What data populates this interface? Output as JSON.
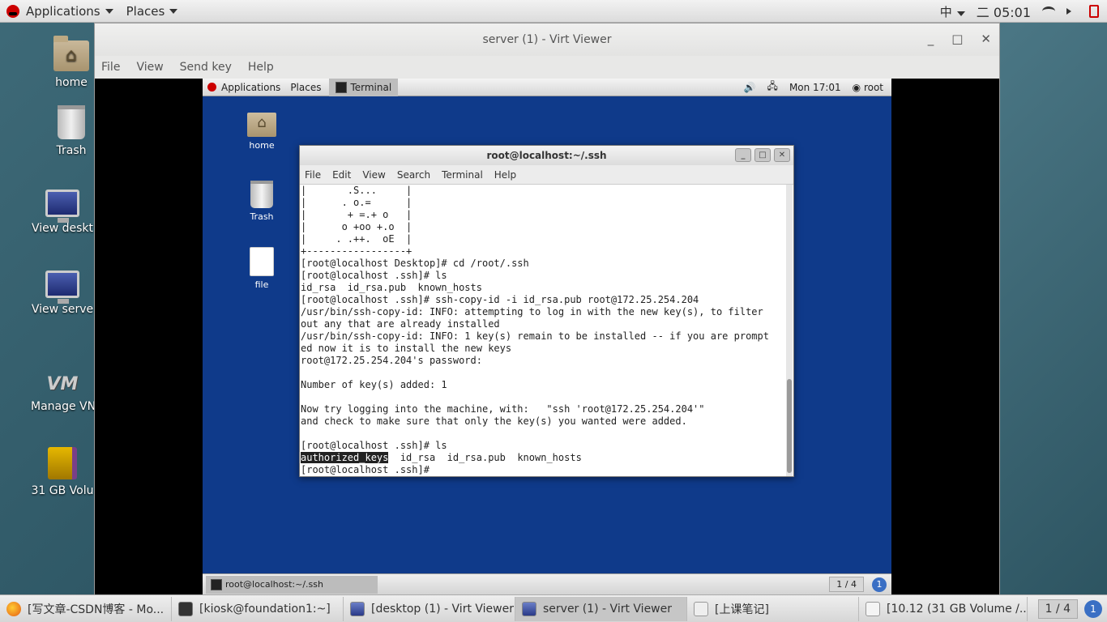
{
  "host_topbar": {
    "applications_label": "Applications",
    "places_label": "Places",
    "input_method": "中",
    "clock": "二 05:01"
  },
  "host_desktop_icons": [
    {
      "label": "home",
      "icon": "folder-home-icon"
    },
    {
      "label": "Trash",
      "icon": "trash-icon"
    },
    {
      "label": "View deskt",
      "icon": "monitor-icon"
    },
    {
      "label": "View serve",
      "icon": "monitor-icon"
    },
    {
      "label": "Manage VN",
      "icon": "vm-icon"
    },
    {
      "label": "31 GB Volu",
      "icon": "drive-icon"
    }
  ],
  "virt_viewer": {
    "title": "server (1) - Virt Viewer",
    "menu": [
      "File",
      "View",
      "Send key",
      "Help"
    ]
  },
  "guest": {
    "topbar": {
      "applications_label": "Applications",
      "places_label": "Places",
      "task_label": "Terminal",
      "clock": "Mon 17:01",
      "user": "root"
    },
    "desktop_icons": [
      {
        "label": "home"
      },
      {
        "label": "Trash"
      },
      {
        "label": "file"
      }
    ],
    "terminal": {
      "title": "root@localhost:~/.ssh",
      "menu": [
        "File",
        "Edit",
        "View",
        "Search",
        "Terminal",
        "Help"
      ],
      "lines": [
        "|       .S...     |",
        "|      . o.=      |",
        "|       + =.+ o   |",
        "|      o +oo +.o  |",
        "|     . .++.  oE  |",
        "+-----------------+",
        "[root@localhost Desktop]# cd /root/.ssh",
        "[root@localhost .ssh]# ls",
        "id_rsa  id_rsa.pub  known_hosts",
        "[root@localhost .ssh]# ssh-copy-id -i id_rsa.pub root@172.25.254.204",
        "/usr/bin/ssh-copy-id: INFO: attempting to log in with the new key(s), to filter",
        "out any that are already installed",
        "/usr/bin/ssh-copy-id: INFO: 1 key(s) remain to be installed -- if you are prompt",
        "ed now it is to install the new keys",
        "root@172.25.254.204's password: ",
        "",
        "Number of key(s) added: 1",
        "",
        "Now try logging into the machine, with:   \"ssh 'root@172.25.254.204'\"",
        "and check to make sure that only the key(s) you wanted were added.",
        "",
        "[root@localhost .ssh]# ls"
      ],
      "last_ls_highlight": "authorized_keys",
      "last_ls_rest": "  id_rsa  id_rsa.pub  known_hosts",
      "final_prompt": "[root@localhost .ssh]# "
    },
    "bottombar": {
      "task_label": "root@localhost:~/.ssh",
      "pager": "1 / 4",
      "info_badge": "1"
    }
  },
  "host_bottombar": {
    "tasks": [
      {
        "label": "[写文章-CSDN博客 - Mo...",
        "icon": "firefox-icon"
      },
      {
        "label": "[kiosk@foundation1:~]",
        "icon": "terminal-icon"
      },
      {
        "label": "[desktop (1) - Virt Viewer]",
        "icon": "monitor-icon"
      },
      {
        "label": "server (1) - Virt Viewer",
        "icon": "monitor-icon"
      },
      {
        "label": "[上课笔记]",
        "icon": "document-icon"
      },
      {
        "label": "[10.12 (31 GB Volume /...",
        "icon": "editor-icon"
      }
    ],
    "pager": "1 / 4",
    "info_badge": "1"
  }
}
